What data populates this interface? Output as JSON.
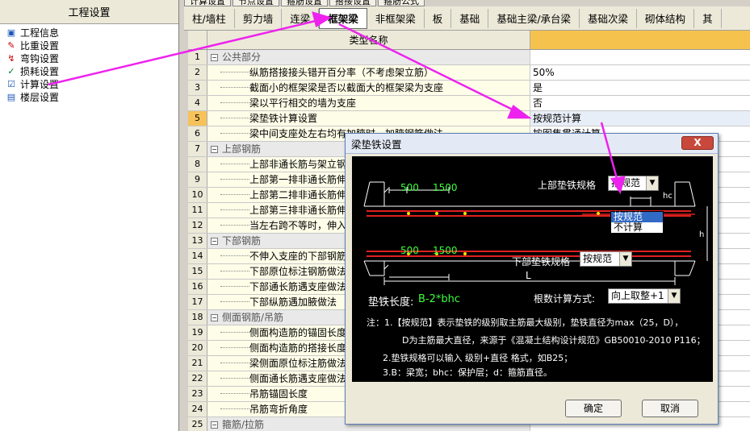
{
  "left_panel": {
    "title": "工程设置",
    "items": [
      {
        "label": "工程信息",
        "icon": "info-icon"
      },
      {
        "label": "比重设置",
        "icon": "weight-icon"
      },
      {
        "label": "弯钩设置",
        "icon": "hook-icon"
      },
      {
        "label": "损耗设置",
        "icon": "loss-icon"
      },
      {
        "label": "计算设置",
        "icon": "calc-icon"
      },
      {
        "label": "楼层设置",
        "icon": "floor-icon"
      }
    ]
  },
  "top_tabs": [
    "计算设置",
    "节点设置",
    "箍筋设置",
    "搭接设置",
    "箍筋公式"
  ],
  "tabs": [
    "柱/墙柱",
    "剪力墙",
    "连梁",
    "框架梁",
    "非框架梁",
    "板",
    "基础",
    "基础主梁/承台梁",
    "基础次梁",
    "砌体结构",
    "其"
  ],
  "active_tab": "框架梁",
  "table": {
    "header_name": "类型名称",
    "rows": [
      {
        "num": "1",
        "name": "公共部分",
        "group": true,
        "value": ""
      },
      {
        "num": "2",
        "name": "纵筋搭接接头错开百分率（不考虑架立筋）",
        "value": "50%"
      },
      {
        "num": "3",
        "name": "截面小的框架梁是否以截面大的框架梁为支座",
        "value": "是"
      },
      {
        "num": "4",
        "name": "梁以平行相交的墙为支座",
        "value": "否"
      },
      {
        "num": "5",
        "name": "梁垫铁计算设置",
        "value": "按规范计算",
        "selected": true
      },
      {
        "num": "6",
        "name": "梁中间支座处左右均有加腋时，加腋钢筋做法",
        "value": "按图集贯通计算"
      },
      {
        "num": "7",
        "name": "上部钢筋",
        "group": true,
        "value": ""
      },
      {
        "num": "8",
        "name": "上部非通长筋与架立钢筋的搭接长度",
        "value": ""
      },
      {
        "num": "9",
        "name": "上部第一排非通长筋伸入跨内的长度",
        "value": ""
      },
      {
        "num": "10",
        "name": "上部第二排非通长筋伸入跨内的长度",
        "value": ""
      },
      {
        "num": "11",
        "name": "上部第三排非通长筋伸入跨内的长度",
        "value": ""
      },
      {
        "num": "12",
        "name": "当左右跨不等时，伸入小跨内负筋的L取值",
        "value": ""
      },
      {
        "num": "13",
        "name": "下部钢筋",
        "group": true,
        "value": ""
      },
      {
        "num": "14",
        "name": "不伸入支座的下部钢筋距支座边的距离",
        "value": ""
      },
      {
        "num": "15",
        "name": "下部原位标注钢筋做法",
        "value": ""
      },
      {
        "num": "16",
        "name": "下部通长筋遇支座做法",
        "value": ""
      },
      {
        "num": "17",
        "name": "下部纵筋遇加腋做法",
        "value": ""
      },
      {
        "num": "18",
        "name": "侧面钢筋/吊筋",
        "group": true,
        "value": ""
      },
      {
        "num": "19",
        "name": "侧面构造筋的锚固长度",
        "value": ""
      },
      {
        "num": "20",
        "name": "侧面构造筋的搭接长度",
        "value": ""
      },
      {
        "num": "21",
        "name": "梁侧面原位标注筋做法",
        "value": ""
      },
      {
        "num": "22",
        "name": "侧面通长筋遇支座做法",
        "value": ""
      },
      {
        "num": "23",
        "name": "吊筋锚固长度",
        "value": ""
      },
      {
        "num": "24",
        "name": "吊筋弯折角度",
        "value": ""
      },
      {
        "num": "25",
        "name": "箍筋/拉筋",
        "group": true,
        "value": ""
      }
    ]
  },
  "dialog": {
    "title": "梁垫铁设置",
    "close_label": "X",
    "upper_label": "上部垫铁规格",
    "upper_value": "按规范",
    "upper_options": [
      "按规范",
      "不计算"
    ],
    "lower_label": "下部垫铁规格",
    "lower_value": "按规范",
    "length_label": "垫铁长度:",
    "length_formula": "B-2*bhc",
    "count_label": "根数计算方式:",
    "count_value": "向上取整+1",
    "dim_500_top": "500",
    "dim_1500_top": "1500",
    "dim_500_bottom": "500",
    "dim_1500_bottom": "1500",
    "dim_hc": "hc",
    "dim_L": "L",
    "dim_h": "h",
    "notes": [
      "注：1.【按规范】表示垫铁的级别取主筋最大级别，垫铁直径为max（25，D），",
      "D为主筋最大直径，来源于《混凝土结构设计规范》GB50010-2010 P116；",
      "2.垫铁规格可以输入 级别+直径 格式，如B25；",
      "3.B：梁宽；bhc：保护层；d：箍筋直径。"
    ],
    "ok_label": "确定",
    "cancel_label": "取消"
  },
  "colors": {
    "annotation_arrow": "#ee22ee",
    "highlight_header": "#f5c24d",
    "dialog_canvas": "#000000"
  }
}
